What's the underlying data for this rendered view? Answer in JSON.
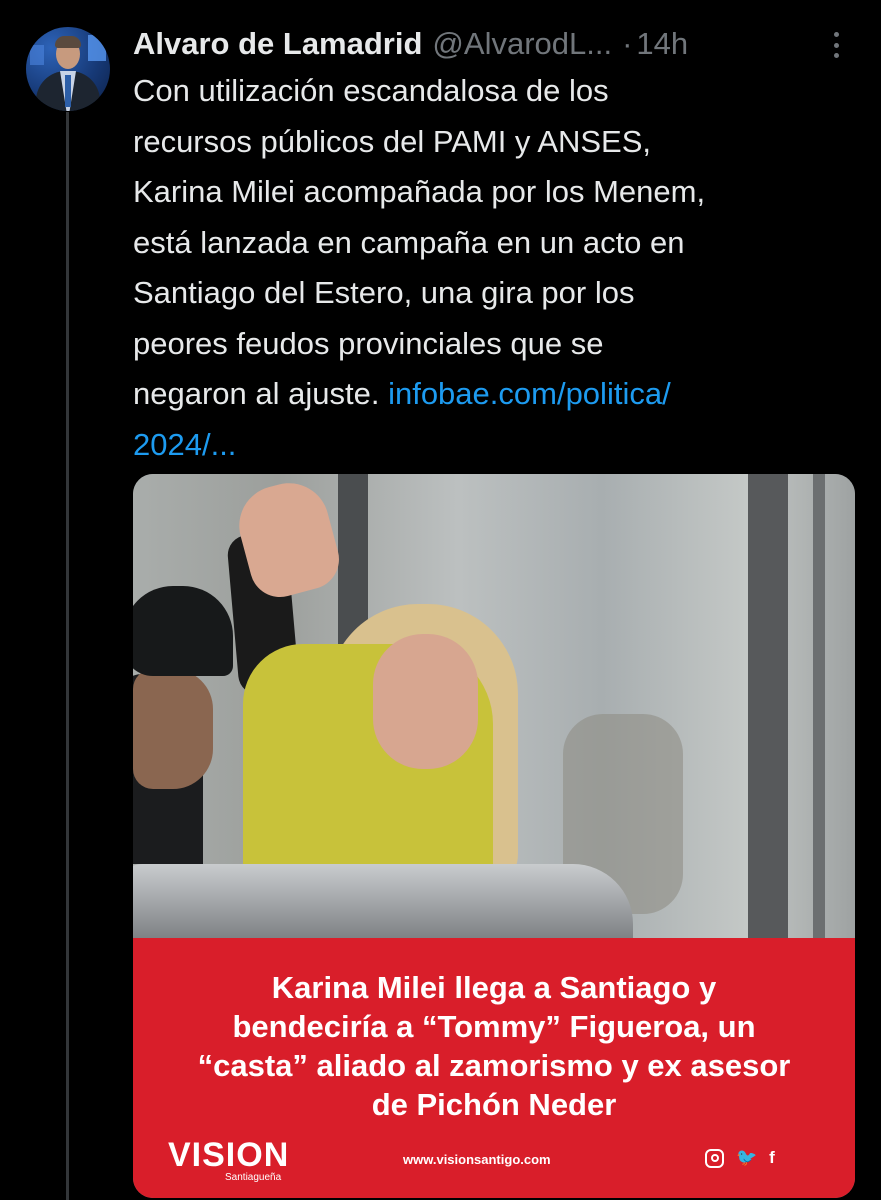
{
  "tweet": {
    "author": {
      "display_name": "Alvaro de Lamadrid",
      "handle": "@AlvarodL...",
      "avatar_icon": "profile-photo"
    },
    "separator": "·",
    "timestamp": "14h",
    "more_icon": "vertical-ellipsis-icon",
    "text_lines": [
      "Con utilización escandalosa de los",
      "recursos públicos del PAMI y ANSES,",
      "Karina Milei acompañada por los Menem,",
      "está lanzada en campaña en un acto en",
      "Santiago del Estero, una gira por los",
      "peores feudos provinciales que se"
    ],
    "last_line_text": "negaron al ajuste. ",
    "link_part1": "infobae.com/politica/",
    "link_part2": "2024/...",
    "colors": {
      "link": "#1d9bf0",
      "muted": "#71767b",
      "text": "#e7e9ea",
      "banner": "#d91e2a"
    }
  },
  "media": {
    "headline_lines": [
      "Karina Milei llega a Santiago y",
      "bendeciría a “Tommy” Figueroa, un",
      "“casta” aliado al zamorismo y ex asesor",
      "de Pichón Neder"
    ],
    "brand": "VISION",
    "brand_sub": "Santiagueña",
    "website": "www.visionsantigo.com",
    "social_icons": [
      "instagram-icon",
      "twitter-icon",
      "facebook-icon"
    ],
    "twitter_glyph": "🐦",
    "facebook_glyph": "f"
  }
}
